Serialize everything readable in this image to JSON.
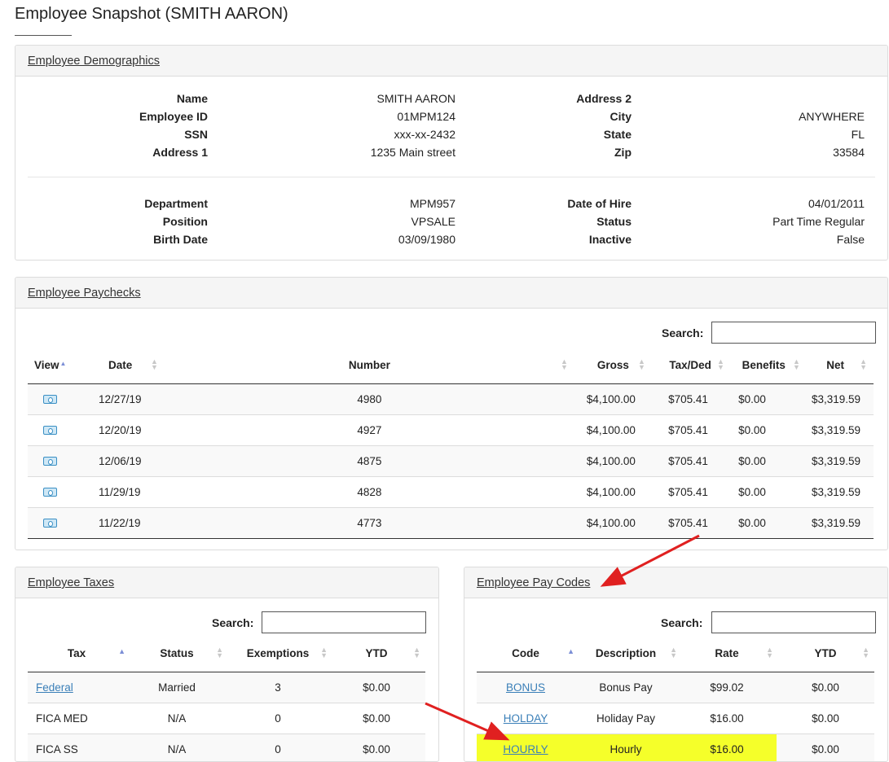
{
  "page_title": "Employee Snapshot (SMITH AARON)",
  "demographics": {
    "header": "Employee Demographics",
    "left_top": [
      {
        "label": "Name",
        "value": "SMITH AARON"
      },
      {
        "label": "Employee ID",
        "value": "01MPM124"
      },
      {
        "label": "SSN",
        "value": "xxx-xx-2432"
      },
      {
        "label": "Address 1",
        "value": "1235 Main street"
      }
    ],
    "right_top": [
      {
        "label": "Address 2",
        "value": ""
      },
      {
        "label": "City",
        "value": "ANYWHERE"
      },
      {
        "label": "State",
        "value": "FL"
      },
      {
        "label": "Zip",
        "value": "33584"
      }
    ],
    "left_bottom": [
      {
        "label": "Department",
        "value": "MPM957"
      },
      {
        "label": "Position",
        "value": "VPSALE"
      },
      {
        "label": "Birth Date",
        "value": "03/09/1980"
      }
    ],
    "right_bottom": [
      {
        "label": "Date of Hire",
        "value": "04/01/2011"
      },
      {
        "label": "Status",
        "value": "Part Time Regular"
      },
      {
        "label": "Inactive",
        "value": "False"
      }
    ]
  },
  "paychecks": {
    "header": "Employee Paychecks",
    "search_label": "Search:",
    "columns": [
      "View",
      "Date",
      "Number",
      "Gross",
      "Tax/Ded",
      "Benefits",
      "Net"
    ],
    "rows": [
      {
        "icon": "cash-icon",
        "date": "12/27/19",
        "number": "4980",
        "gross": "$4,100.00",
        "tax": "$705.41",
        "benefits": "$0.00",
        "net": "$3,319.59"
      },
      {
        "icon": "cash-icon",
        "date": "12/20/19",
        "number": "4927",
        "gross": "$4,100.00",
        "tax": "$705.41",
        "benefits": "$0.00",
        "net": "$3,319.59"
      },
      {
        "icon": "cash-icon",
        "date": "12/06/19",
        "number": "4875",
        "gross": "$4,100.00",
        "tax": "$705.41",
        "benefits": "$0.00",
        "net": "$3,319.59"
      },
      {
        "icon": "cash-icon",
        "date": "11/29/19",
        "number": "4828",
        "gross": "$4,100.00",
        "tax": "$705.41",
        "benefits": "$0.00",
        "net": "$3,319.59"
      },
      {
        "icon": "cash-icon",
        "date": "11/22/19",
        "number": "4773",
        "gross": "$4,100.00",
        "tax": "$705.41",
        "benefits": "$0.00",
        "net": "$3,319.59"
      }
    ]
  },
  "taxes": {
    "header": "Employee Taxes",
    "search_label": "Search:",
    "columns": [
      "Tax",
      "Status",
      "Exemptions",
      "YTD"
    ],
    "rows": [
      {
        "tax": "Federal",
        "is_link": true,
        "status": "Married",
        "exemptions": "3",
        "ytd": "$0.00"
      },
      {
        "tax": "FICA MED",
        "is_link": false,
        "status": "N/A",
        "exemptions": "0",
        "ytd": "$0.00"
      },
      {
        "tax": "FICA SS",
        "is_link": false,
        "status": "N/A",
        "exemptions": "0",
        "ytd": "$0.00"
      }
    ]
  },
  "pay_codes": {
    "header": "Employee Pay Codes",
    "search_label": "Search:",
    "columns": [
      "Code",
      "Description",
      "Rate",
      "YTD"
    ],
    "rows": [
      {
        "code": "BONUS",
        "description": "Bonus Pay",
        "rate": "$99.02",
        "ytd": "$0.00",
        "highlighted": false
      },
      {
        "code": "HOLDAY",
        "description": "Holiday Pay",
        "rate": "$16.00",
        "ytd": "$0.00",
        "highlighted": false
      },
      {
        "code": "HOURLY",
        "description": "Hourly",
        "rate": "$16.00",
        "ytd": "$0.00",
        "highlighted": true
      }
    ]
  },
  "colors": {
    "highlight": "#f5ff2a",
    "annotation_arrow": "#e02020",
    "link": "#3a7fb8",
    "sort_active": "#7b8ed6"
  }
}
